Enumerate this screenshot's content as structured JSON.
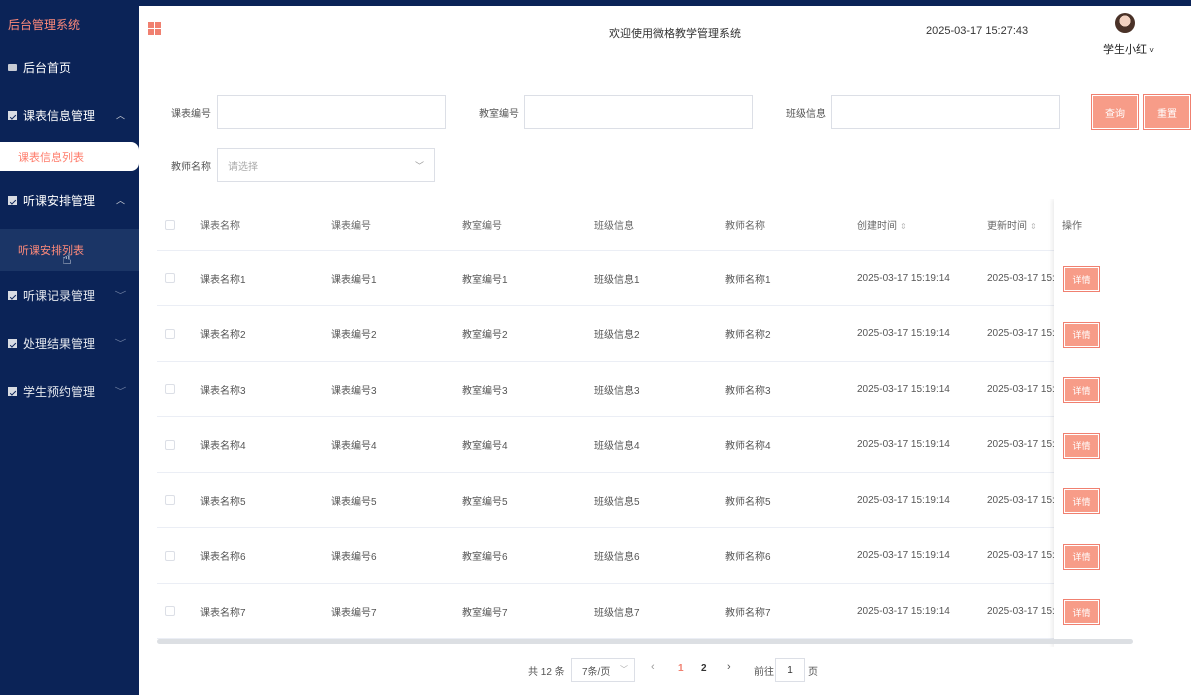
{
  "sidebar": {
    "brand": "后台管理系统",
    "home": "后台首页",
    "menu": [
      {
        "label": "课表信息管理",
        "arrow": "^",
        "sub": "课表信息列表"
      },
      {
        "label": "听课安排管理",
        "arrow": "^",
        "sub": "听课安排列表"
      },
      {
        "label": "听课记录管理",
        "arrow": "v"
      },
      {
        "label": "处理结果管理",
        "arrow": "v"
      },
      {
        "label": "学生预约管理",
        "arrow": "v"
      }
    ]
  },
  "header": {
    "welcome": "欢迎使用微格教学管理系统",
    "datetime": "2025-03-17 15:27:43",
    "username": "学生小红"
  },
  "search": {
    "course_no_label": "课表编号",
    "classroom_no_label": "教室编号",
    "class_info_label": "班级信息",
    "teacher_label": "教师名称",
    "teacher_placeholder": "请选择",
    "query_btn": "查询",
    "reset_btn": "重置"
  },
  "table": {
    "headers": [
      "课表名称",
      "课表编号",
      "教室编号",
      "班级信息",
      "教师名称",
      "创建时间",
      "更新时间",
      "操作"
    ],
    "rows": [
      [
        "课表名称1",
        "课表编号1",
        "教室编号1",
        "班级信息1",
        "教师名称1",
        "2025-03-17 15:19:14",
        "2025-03-17 15:1"
      ],
      [
        "课表名称2",
        "课表编号2",
        "教室编号2",
        "班级信息2",
        "教师名称2",
        "2025-03-17 15:19:14",
        "2025-03-17 15:1"
      ],
      [
        "课表名称3",
        "课表编号3",
        "教室编号3",
        "班级信息3",
        "教师名称3",
        "2025-03-17 15:19:14",
        "2025-03-17 15:1"
      ],
      [
        "课表名称4",
        "课表编号4",
        "教室编号4",
        "班级信息4",
        "教师名称4",
        "2025-03-17 15:19:14",
        "2025-03-17 15:1"
      ],
      [
        "课表名称5",
        "课表编号5",
        "教室编号5",
        "班级信息5",
        "教师名称5",
        "2025-03-17 15:19:14",
        "2025-03-17 15:1"
      ],
      [
        "课表名称6",
        "课表编号6",
        "教室编号6",
        "班级信息6",
        "教师名称6",
        "2025-03-17 15:19:14",
        "2025-03-17 15:1"
      ],
      [
        "课表名称7",
        "课表编号7",
        "教室编号7",
        "班级信息7",
        "教师名称7",
        "2025-03-17 15:19:14",
        "2025-03-17 15:1"
      ]
    ],
    "detail_btn": "详情"
  },
  "pagination": {
    "total": "共 12 条",
    "page_size": "7条/页",
    "pages": [
      "1",
      "2"
    ],
    "goto_label": "前往",
    "goto_value": "1",
    "page_suffix": "页"
  },
  "colors": {
    "sidebar_bg": "#0b2357",
    "accent": "#f79c88",
    "active_page": "#f08070"
  }
}
